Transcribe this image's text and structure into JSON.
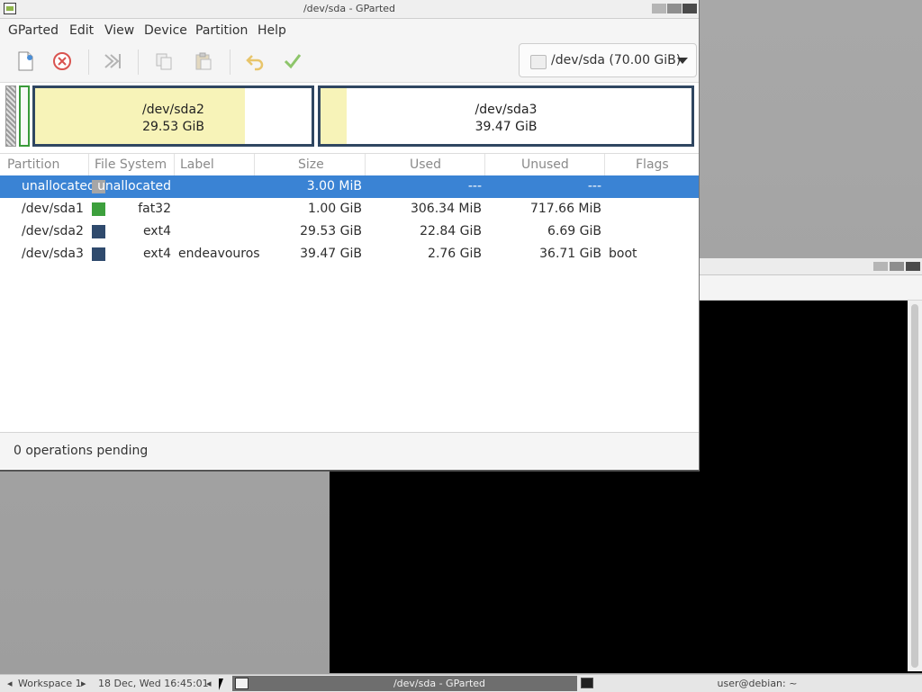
{
  "window": {
    "title": "/dev/sda - GParted"
  },
  "menu": [
    "GParted",
    "Edit",
    "View",
    "Device",
    "Partition",
    "Help"
  ],
  "toolbar": {
    "buttons": [
      "new-partition",
      "delete-partition",
      "resize-move",
      "copy",
      "paste",
      "undo",
      "apply"
    ],
    "device_selector": "/dev/sda (70.00 GiB)"
  },
  "partition_map": {
    "segments": [
      {
        "name": "/dev/sda2",
        "size": "29.53 GiB",
        "used_fraction": 0.76
      },
      {
        "name": "/dev/sda3",
        "size": "39.47 GiB",
        "used_fraction": 0.07
      }
    ]
  },
  "table": {
    "headers": [
      "Partition",
      "File System",
      "Label",
      "Size",
      "Used",
      "Unused",
      "Flags"
    ],
    "rows": [
      {
        "partition": "unallocated",
        "fs": "unallocated",
        "label": "",
        "size": "3.00 MiB",
        "used": "---",
        "unused": "---",
        "flags": "",
        "color": "#a6a6a6",
        "selected": true
      },
      {
        "partition": "/dev/sda1",
        "fs": "fat32",
        "label": "",
        "size": "1.00 GiB",
        "used": "306.34 MiB",
        "unused": "717.66 MiB",
        "flags": "",
        "color": "#3da03d",
        "selected": false
      },
      {
        "partition": "/dev/sda2",
        "fs": "ext4",
        "label": "",
        "size": "29.53 GiB",
        "used": "22.84 GiB",
        "unused": "6.69 GiB",
        "flags": "",
        "color": "#2f4a6d",
        "selected": false
      },
      {
        "partition": "/dev/sda3",
        "fs": "ext4",
        "label": "endeavouros",
        "size": "39.47 GiB",
        "used": "2.76 GiB",
        "unused": "36.71 GiB",
        "flags": "boot",
        "color": "#2f4a6d",
        "selected": false
      }
    ]
  },
  "status": {
    "text": "0 operations pending"
  },
  "taskbar": {
    "workspace": "Workspace 1",
    "clock": "18 Dec, Wed 16:45:01",
    "tasks": [
      "/dev/sda - GParted",
      "user@debian: ~"
    ]
  },
  "colors": {
    "selection": "#3a83d4",
    "partition_border": "#2f4661",
    "used_fill": "#f7f3b8"
  }
}
